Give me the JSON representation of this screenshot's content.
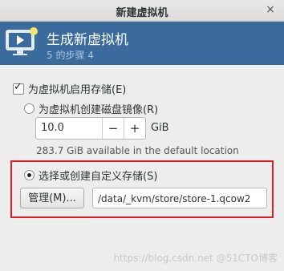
{
  "window": {
    "title": "新建虚拟机",
    "close_glyph": "×"
  },
  "header": {
    "title": "生成新虚拟机",
    "step": "5 的步骤 4"
  },
  "storage": {
    "enable_label": "为虚拟机启用存储(E)",
    "enable_checked": true,
    "create_image_label": "为虚拟机创建磁盘镜像(R)",
    "create_image_selected": false,
    "size_value": "10.0",
    "minus_label": "−",
    "plus_label": "+",
    "size_unit": "GiB",
    "available_info": "283.7 GiB available in the default location",
    "custom_label": "选择或创建自定义存储(S)",
    "custom_selected": true,
    "manage_button": "管理(M)...",
    "custom_path": "/data/_kvm/store/store-1.qcow2"
  },
  "watermark": "https://blog.csdn.net @51CTO博客",
  "colors": {
    "banner": "#3b6b9c",
    "highlight": "#e02020"
  }
}
